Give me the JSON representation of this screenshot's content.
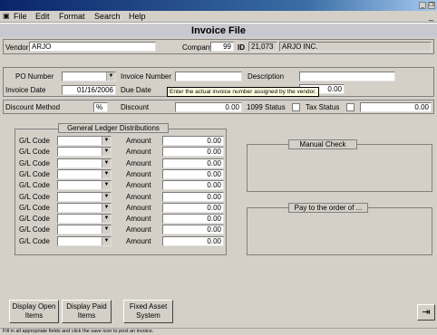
{
  "menu": [
    {
      "label": "File",
      "icon": "app-icon"
    },
    {
      "label": "Edit"
    },
    {
      "label": "Format"
    },
    {
      "label": "Search"
    },
    {
      "label": "Help"
    }
  ],
  "window_buttons": {
    "minimize": "_",
    "restore": "❐"
  },
  "heading": "Invoice File",
  "vendor": {
    "label": "Vendor",
    "value": "ARJO"
  },
  "company": {
    "label": "Company",
    "value": "99"
  },
  "id": {
    "label": "ID",
    "value": "21,073",
    "name": "ARJO INC."
  },
  "po": {
    "label": "PO Number",
    "value": ""
  },
  "invoice_number": {
    "label": "Invoice Number",
    "value": ""
  },
  "description": {
    "label": "Description",
    "value": ""
  },
  "invoice_date": {
    "label": "Invoice Date",
    "value": "01/16/2006"
  },
  "due_date": {
    "label": "Due Date"
  },
  "amount_top": {
    "value": "0.00"
  },
  "tooltip": "Enter the actual invoice number assigned by the vendor.",
  "discount_method": {
    "label": "Discount Method",
    "value": "%"
  },
  "discount": {
    "label": "Discount",
    "value": "0.00"
  },
  "status_1099": {
    "label": "1099 Status"
  },
  "tax_status": {
    "label": "Tax Status",
    "value": "0.00"
  },
  "gl": {
    "title": "General Ledger Distributions",
    "code_label": "G/L Code",
    "amount_label": "Amount",
    "rows": [
      {
        "amount": "0.00"
      },
      {
        "amount": "0.00"
      },
      {
        "amount": "0.00"
      },
      {
        "amount": "0.00"
      },
      {
        "amount": "0.00"
      },
      {
        "amount": "0.00"
      },
      {
        "amount": "0.00"
      },
      {
        "amount": "0.00"
      },
      {
        "amount": "0.00"
      },
      {
        "amount": "0.00"
      }
    ]
  },
  "manual_check": {
    "title": "Manual Check"
  },
  "pay_to": {
    "title": "Pay to the order of ..."
  },
  "buttons": {
    "display_open": "Display Open Items",
    "display_paid": "Display Paid Items",
    "fixed_asset": "Fixed Asset System"
  },
  "exit_icon": "exit-door-icon",
  "status_text": "Fill in all appropriate fields and click the save icon to post an invoice."
}
